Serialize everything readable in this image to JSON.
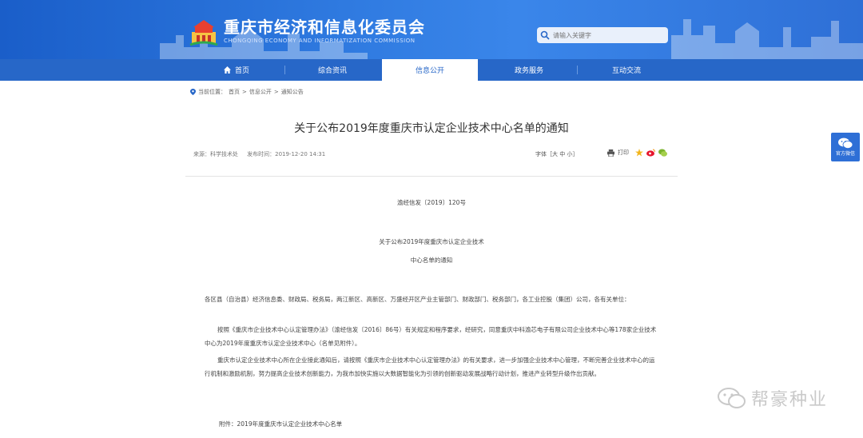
{
  "header": {
    "title_cn": "重庆市经济和信息化委员会",
    "title_en": "CHONGQING ECONOMY AND INFORMATIZATION COMMISSION",
    "search_placeholder": "请输入关键字",
    "brand_color": "#2767c8"
  },
  "nav": {
    "items": [
      {
        "label": "首页",
        "icon": "home-icon"
      },
      {
        "label": "综合资讯"
      },
      {
        "label": "信息公开"
      },
      {
        "label": "政务服务"
      },
      {
        "label": "互动交流"
      }
    ],
    "active_index": 2
  },
  "breadcrumb": {
    "prefix": "当前位置：",
    "items": [
      "首页",
      "信息公开",
      "通知公告"
    ],
    "separator": ">"
  },
  "article": {
    "title": "关于公布2019年度重庆市认定企业技术中心名单的通知",
    "source": "来源：科学技术处",
    "date": "发布时间：2019-12-20 14:31",
    "font_size_label": "字体［大 中 小］",
    "print_label": "打印",
    "doc_number": "渝经信发〔2019〕120号",
    "heading_line1": "关于公布2019年度重庆市认定企业技术",
    "heading_line2": "中心名单的通知",
    "para1": "各区县（自治县）经济信息委、财政局、税务局，两江新区、高新区、万盛经开区产业主管部门、财政部门、税务部门，各工业控股（集团）公司，各有关单位：",
    "para2": "按照《重庆市企业技术中心认定管理办法》（渝经信发〔2016〕86号）有关规定和程序要求，经研究，同意重庆中科渝芯电子有限公司企业技术中心等178家企业技术中心为2019年度重庆市认定企业技术中心（名单见附件）。",
    "para3": "重庆市认定企业技术中心所在企业接此通知后，请按照《重庆市企业技术中心认定管理办法》的有关要求，进一步加强企业技术中心管理，不断完善企业技术中心的运行机制和激励机制，努力提高企业技术创新能力，为我市加快实施以大数据智能化为引领的创新驱动发展战略行动计划，推进产业转型升级作出贡献。",
    "attachment": "附件：2019年度重庆市认定企业技术中心名单"
  },
  "side": {
    "wechat_label": "官方微信"
  },
  "watermark": {
    "text": "帮豪种业"
  }
}
